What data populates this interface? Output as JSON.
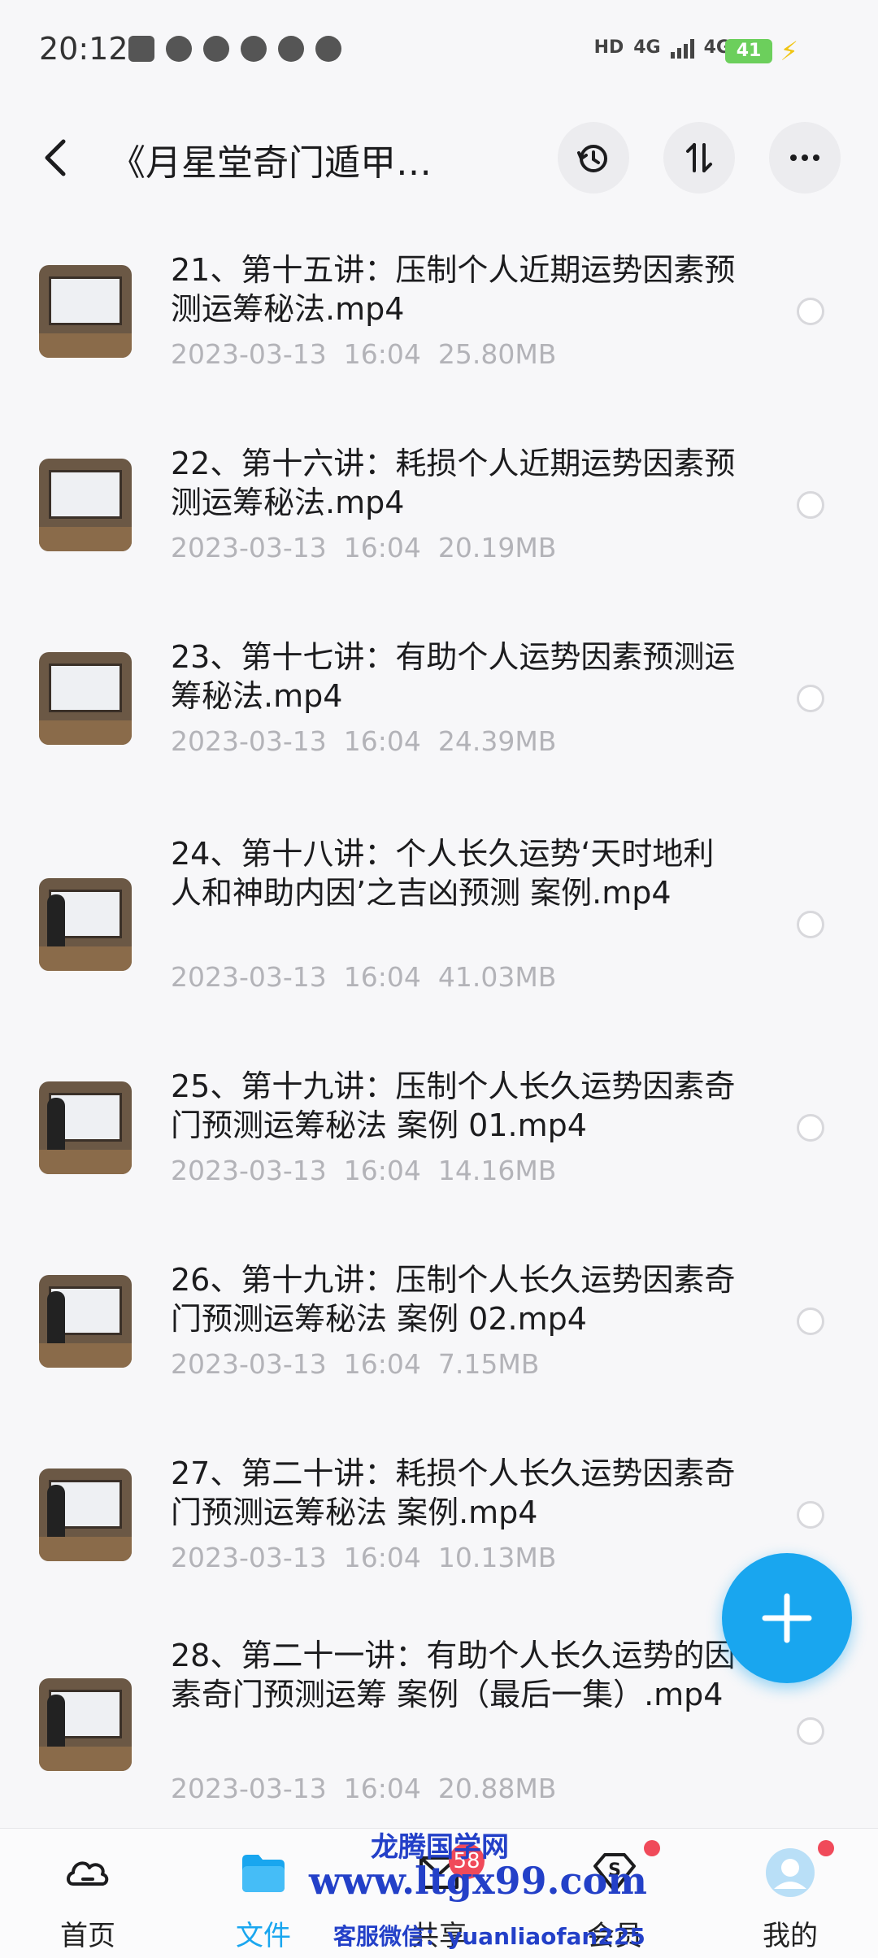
{
  "status_bar": {
    "time": "20:12",
    "network_1": "HD",
    "network_2": "4G",
    "network_3": "4G",
    "battery": "41"
  },
  "header": {
    "title": "《月星堂奇门遁甲…",
    "icons": [
      "back-icon",
      "history-icon",
      "sort-icon",
      "more-icon"
    ]
  },
  "files": [
    {
      "name": "21、第十五讲：压制个人近期运势因素预测运筹秘法.mp4",
      "date": "2023-03-13",
      "time": "16:04",
      "size": "25.80MB",
      "thumb_person": false
    },
    {
      "name": "22、第十六讲：耗损个人近期运势因素预测运筹秘法.mp4",
      "date": "2023-03-13",
      "time": "16:04",
      "size": "20.19MB",
      "thumb_person": false
    },
    {
      "name": "23、第十七讲：有助个人运势因素预测运筹秘法.mp4",
      "date": "2023-03-13",
      "time": "16:04",
      "size": "24.39MB",
      "thumb_person": false
    },
    {
      "name": "24、第十八讲：个人长久运势‘天时地利人和神助内因’之吉凶预测 案例.mp4",
      "date": "2023-03-13",
      "time": "16:04",
      "size": "41.03MB",
      "thumb_person": true
    },
    {
      "name": "25、第十九讲：压制个人长久运势因素奇门预测运筹秘法 案例 01.mp4",
      "date": "2023-03-13",
      "time": "16:04",
      "size": "14.16MB",
      "thumb_person": true
    },
    {
      "name": "26、第十九讲：压制个人长久运势因素奇门预测运筹秘法 案例 02.mp4",
      "date": "2023-03-13",
      "time": "16:04",
      "size": "7.15MB",
      "thumb_person": true
    },
    {
      "name": "27、第二十讲：耗损个人长久运势因素奇门预测运筹秘法 案例.mp4",
      "date": "2023-03-13",
      "time": "16:04",
      "size": "10.13MB",
      "thumb_person": true
    },
    {
      "name": "28、第二十一讲：有助个人长久运势的因素奇门预测运筹 案例（最后一集）.mp4",
      "date": "2023-03-13",
      "time": "16:04",
      "size": "20.88MB",
      "thumb_person": true
    }
  ],
  "fab": {
    "icon": "plus-icon"
  },
  "bottom_nav": {
    "items": [
      {
        "label": "首页",
        "icon": "cloud-home-icon"
      },
      {
        "label": "文件",
        "icon": "folder-icon",
        "active": true
      },
      {
        "label": "共享",
        "icon": "share-icon",
        "badge": "58"
      },
      {
        "label": "会员",
        "icon": "vip-diamond-icon"
      },
      {
        "label": "我的",
        "icon": "avatar-icon"
      }
    ]
  },
  "watermark": {
    "title": "龙腾国学网",
    "url": "www.ltgx99.com",
    "contact": "客服微信：yuanliaofan225"
  },
  "colors": {
    "accent": "#19a6ef",
    "badge": "#f04a5a",
    "meta_text": "#b3b3b8",
    "watermark": "#2340c8"
  }
}
